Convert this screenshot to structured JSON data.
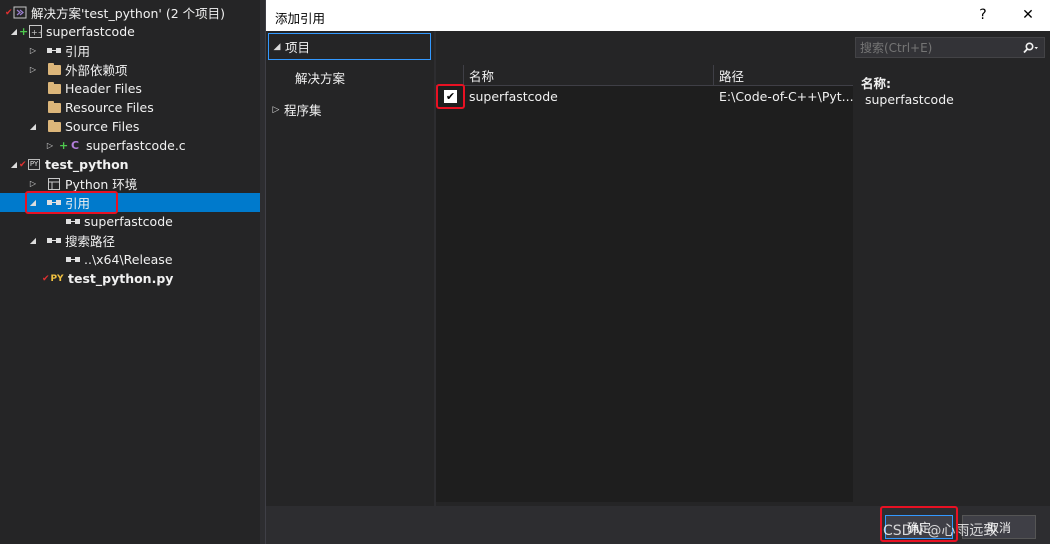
{
  "solution_explorer": {
    "items": [
      {
        "label": "解决方案'test_python' (2 个项目)"
      },
      {
        "label": "superfastcode"
      },
      {
        "label": "引用"
      },
      {
        "label": "外部依赖项"
      },
      {
        "label": "Header Files"
      },
      {
        "label": "Resource Files"
      },
      {
        "label": "Source Files"
      },
      {
        "label": "superfastcode.c"
      },
      {
        "label": "test_python"
      },
      {
        "label": "Python 环境"
      },
      {
        "label": "引用"
      },
      {
        "label": "superfastcode"
      },
      {
        "label": "搜索路径"
      },
      {
        "label": "..\\x64\\Release"
      },
      {
        "label": "test_python.py"
      }
    ],
    "selected_index": 10,
    "icons": {
      "c_file": "C",
      "py_badge": "PY"
    }
  },
  "dialog": {
    "title": "添加引用",
    "help_glyph": "?",
    "close_glyph": "✕",
    "nav": [
      {
        "label": "项目",
        "expanded": true
      },
      {
        "label": "解决方案"
      },
      {
        "label": "程序集",
        "expanded": false
      }
    ],
    "list": {
      "columns": [
        "名称",
        "路径"
      ],
      "rows": [
        {
          "checked": true,
          "check_glyph": "✔",
          "name": "superfastcode",
          "path": "E:\\Code-of-C++\\Pyt..."
        }
      ]
    },
    "search": {
      "placeholder": "搜索(Ctrl+E)"
    },
    "detail": {
      "name_label": "名称:",
      "name_value": "superfastcode"
    },
    "buttons": {
      "ok": "确定",
      "cancel": "取消"
    },
    "watermark": "CSDN @心雨远致"
  },
  "colors": {
    "selection": "#007acc",
    "highlight": "#e81123",
    "panel": "#252526",
    "dialog_bg": "#2d2d30"
  }
}
